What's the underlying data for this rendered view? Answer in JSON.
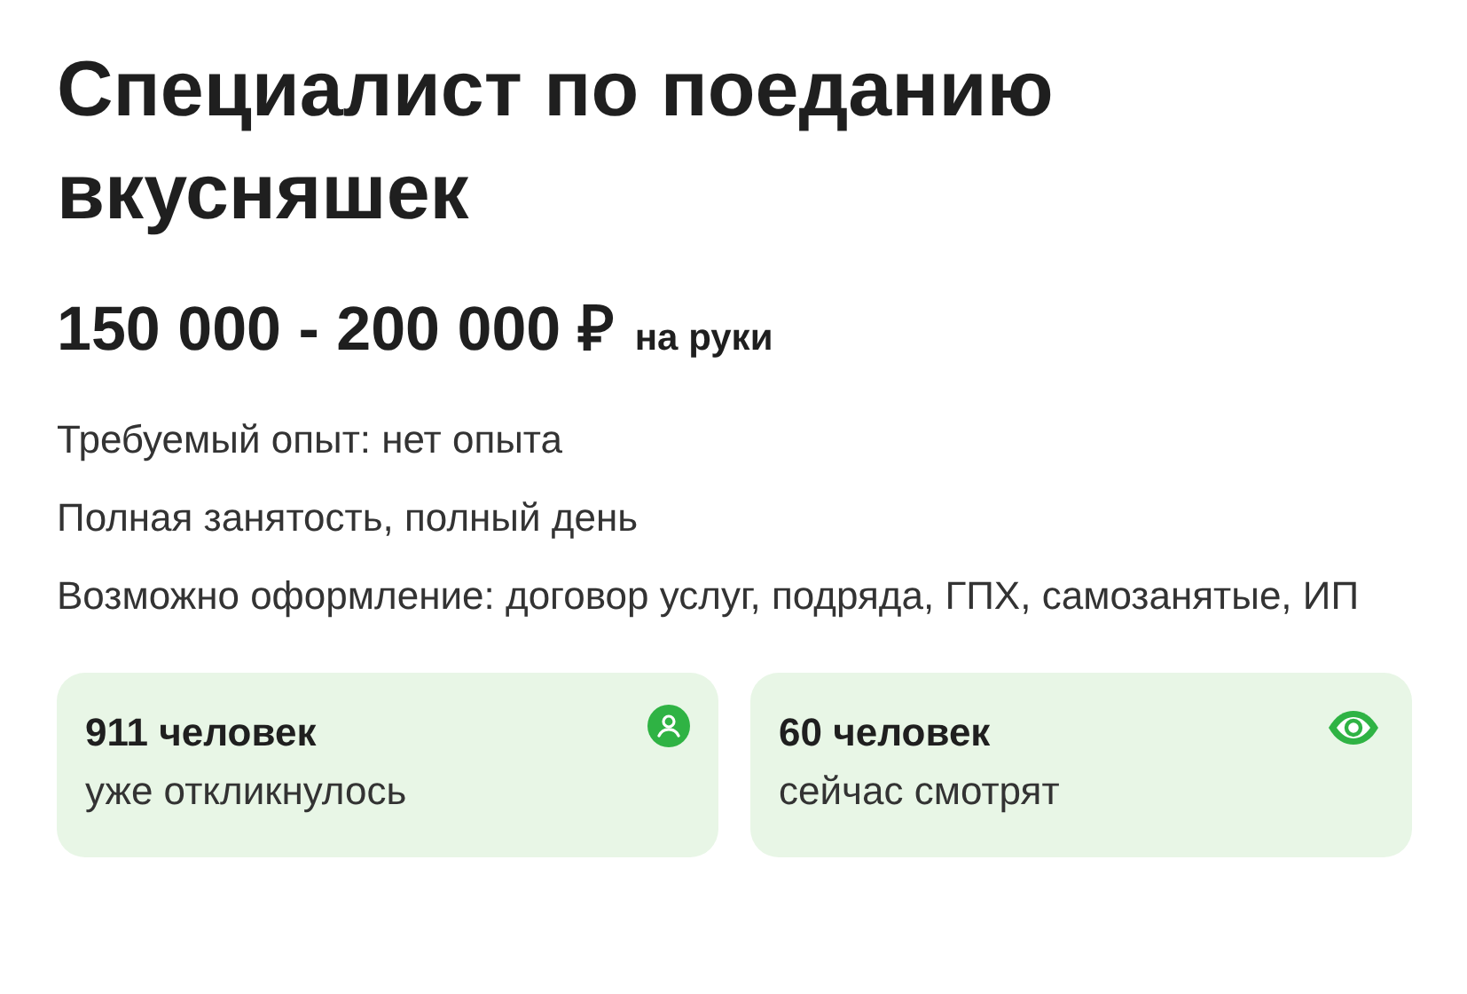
{
  "title": "Специалист по поеданию вкусняшек",
  "salary": {
    "amount": "150 000 - 200 000 ₽",
    "note": "на руки"
  },
  "details": [
    "Требуемый опыт: нет опыта",
    "Полная занятость, полный день",
    "Возможно оформление: договор услуг, подряда, ГПХ, самозанятые, ИП"
  ],
  "stats": [
    {
      "kind": "responses",
      "count": "911 человек",
      "caption": "уже откликнулось"
    },
    {
      "kind": "viewers",
      "count": "60 человек",
      "caption": "сейчас смотрят"
    }
  ]
}
